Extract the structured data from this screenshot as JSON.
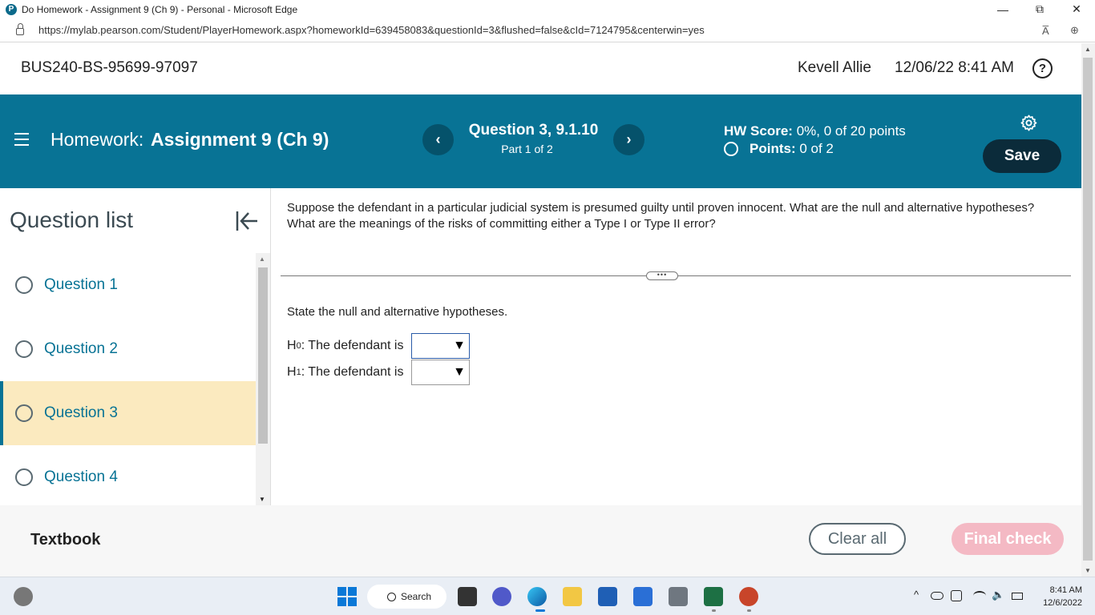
{
  "browser": {
    "title": "Do Homework - Assignment 9 (Ch 9) - Personal - Microsoft Edge",
    "url": "https://mylab.pearson.com/Student/PlayerHomework.aspx?homeworkId=639458083&questionId=3&flushed=false&cId=7124795&centerwin=yes",
    "minimize": "—",
    "restore": "⧉",
    "close": "✕",
    "read_aloud": "A̅",
    "zoom": "⊕"
  },
  "header": {
    "course_id": "BUS240-BS-95699-97097",
    "user_name": "Kevell Allie",
    "datetime": "12/06/22 8:41 AM",
    "help": "?"
  },
  "toolbar": {
    "homework_label": "Homework:",
    "assignment_name": "Assignment 9 (Ch 9)",
    "prev": "‹",
    "next": "›",
    "question_title": "Question 3, 9.1.10",
    "part": "Part 1 of 2",
    "hw_score_label": "HW Score:",
    "hw_score_value": "0%, 0 of 20 points",
    "points_label": "Points:",
    "points_value": "0 of 2",
    "save_label": "Save"
  },
  "question_list": {
    "title": "Question list",
    "items": [
      {
        "label": "Question 1"
      },
      {
        "label": "Question 2"
      },
      {
        "label": "Question 3"
      },
      {
        "label": "Question 4"
      }
    ],
    "active_index": 2
  },
  "question": {
    "prompt": "Suppose the defendant in a particular judicial system is presumed guilty until proven innocent. What are the null and alternative hypotheses? What are the meanings of the risks of committing either a Type I or Type II error?",
    "expand_pill": "•••",
    "instruction": "State the null and alternative hypotheses.",
    "h0_label": "H",
    "h0_sub": "0",
    "h0_text": ": The defendant is",
    "h1_label": "H",
    "h1_sub": "1",
    "h1_text": ": The defendant is",
    "h0_value": "",
    "h1_value": "",
    "dropdown_arrow": "▼"
  },
  "footer": {
    "textbook_label": "Textbook",
    "clear_all_label": "Clear all",
    "final_check_label": "Final check"
  },
  "taskbar": {
    "search_label": "Search",
    "clock_time": "8:41 AM",
    "clock_date": "12/6/2022",
    "tray_chevron": "^",
    "tray_volume": "🔈"
  },
  "colors": {
    "brand_teal": "#087395",
    "save_button": "#0b2b3a",
    "active_question_bg": "#fbeabf",
    "final_check_disabled": "#f4b9c4"
  }
}
